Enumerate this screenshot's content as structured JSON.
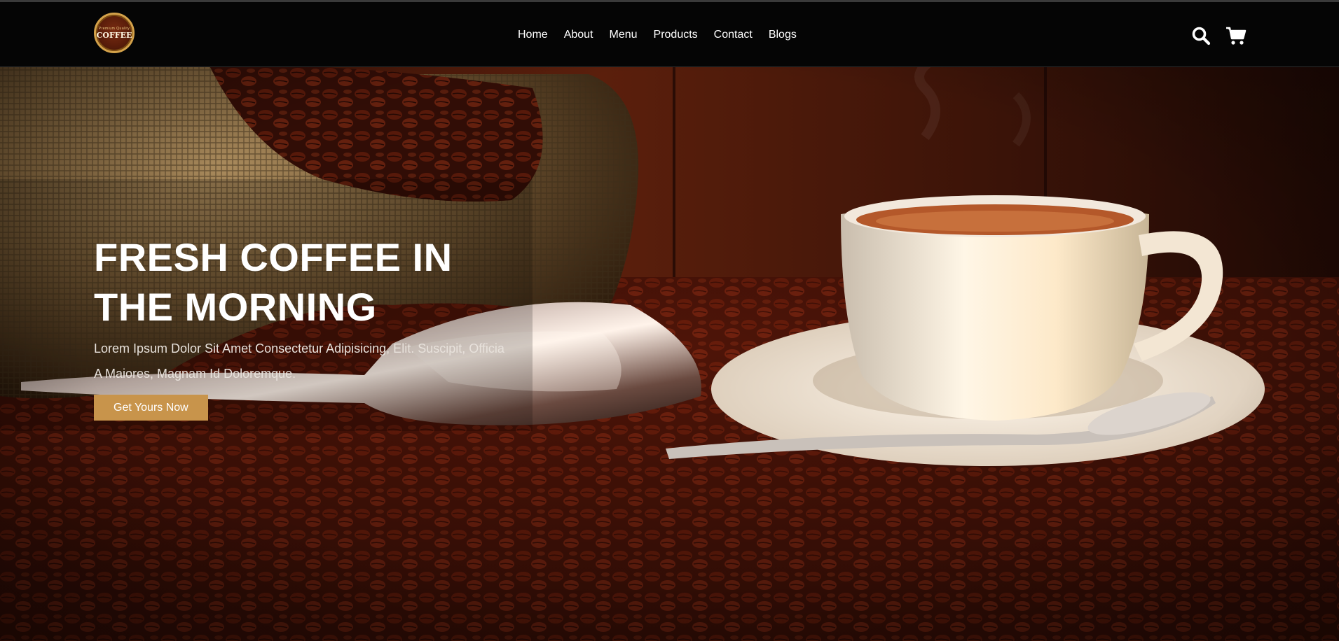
{
  "brand": {
    "logo_top_text": "Premium Quality",
    "logo_main_text": "COFFEE"
  },
  "nav": {
    "items": [
      "Home",
      "About",
      "Menu",
      "Products",
      "Contact",
      "Blogs"
    ]
  },
  "header_icons": {
    "search": "search-icon",
    "cart": "cart-icon"
  },
  "hero": {
    "title_line1": "FRESH COFFEE IN",
    "title_line2": "THE MORNING",
    "subtitle": "Lorem Ipsum Dolor Sit Amet Consectetur Adipisicing, Elit. Suscipit, Officia A Maiores, Magnam Id Doloremque.",
    "cta_label": "Get Yours Now"
  },
  "colors": {
    "header_bg": "#050505",
    "accent": "#c8944b",
    "text": "#ffffff"
  }
}
